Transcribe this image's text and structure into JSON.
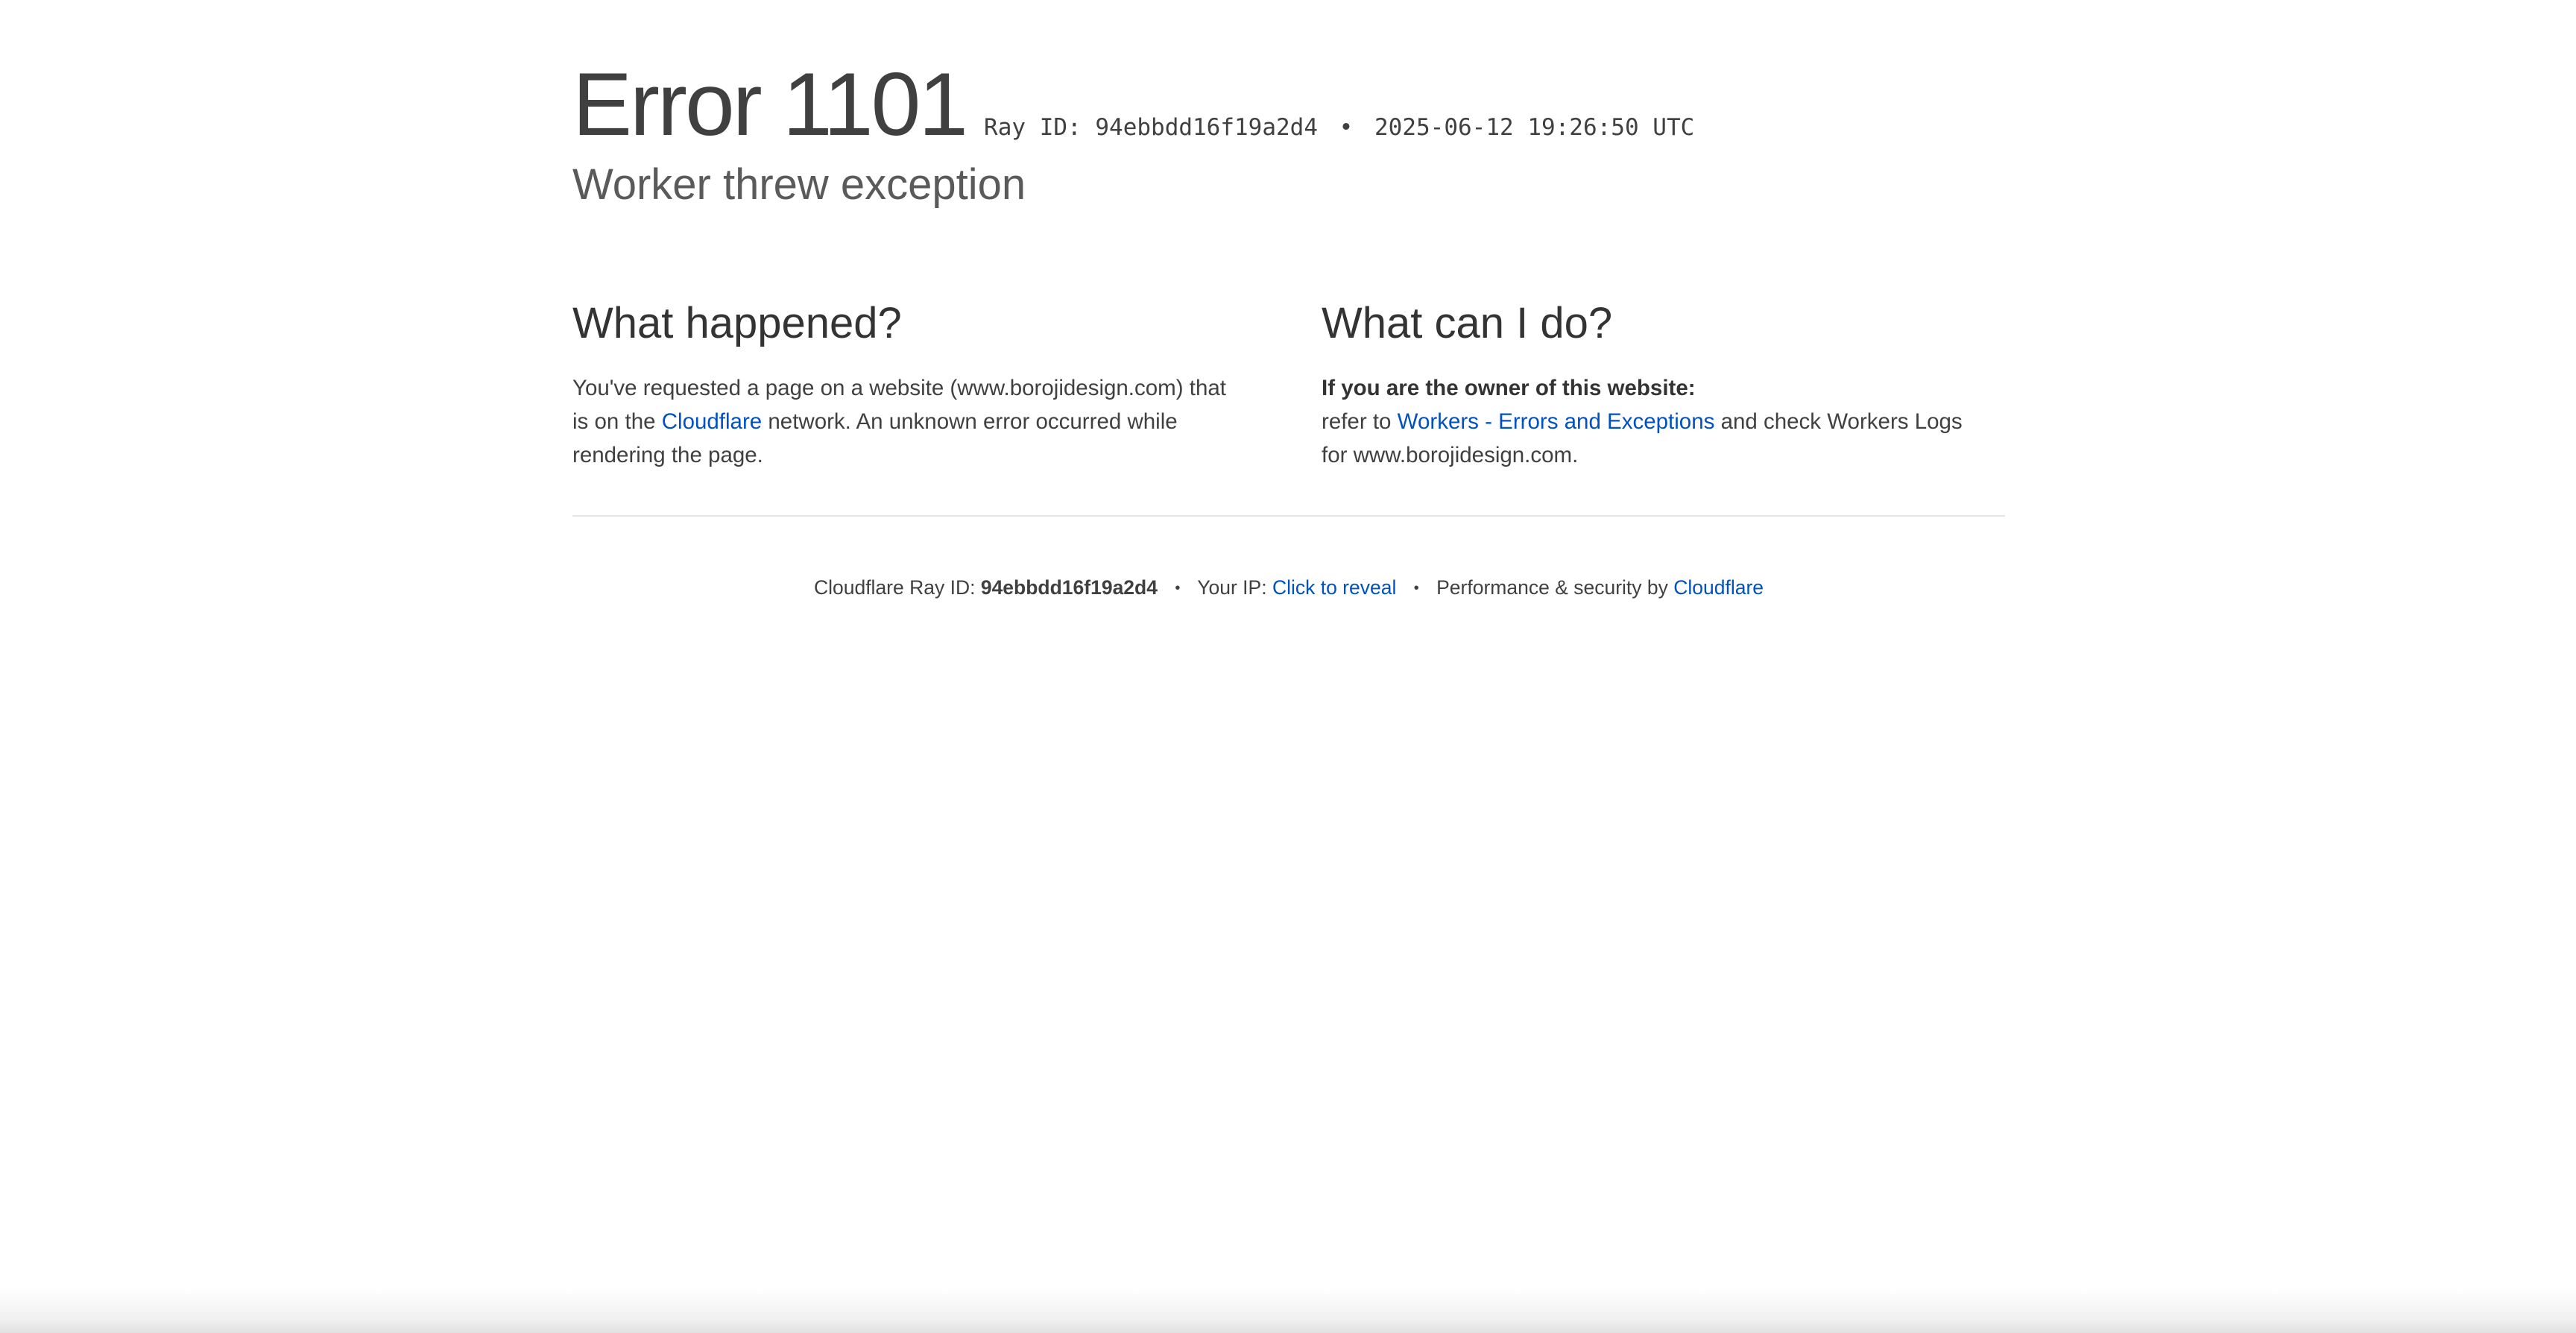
{
  "header": {
    "error_title": "Error 1101",
    "ray_label": "Ray ID:",
    "ray_id": "94ebbdd16f19a2d4",
    "bullet": "•",
    "timestamp": "2025-06-12 19:26:50 UTC",
    "subtitle": "Worker threw exception"
  },
  "what_happened": {
    "heading": "What happened?",
    "text_before_link": "You've requested a page on a website (www.borojidesign.com) that is on the ",
    "link_text": "Cloudflare",
    "text_after_link": " network. An unknown error occurred while rendering the page."
  },
  "what_can_i_do": {
    "heading": "What can I do?",
    "owner_label": "If you are the owner of this website:",
    "text_before_link": "refer to ",
    "link_text": "Workers - Errors and Exceptions",
    "text_after_link": " and check Workers Logs for www.borojidesign.com."
  },
  "footer": {
    "ray_label": "Cloudflare Ray ID: ",
    "ray_id": "94ebbdd16f19a2d4",
    "separator": "•",
    "ip_label": "Your IP: ",
    "ip_link": "Click to reveal",
    "perf_label": "Performance & security by ",
    "perf_link": "Cloudflare"
  },
  "colors": {
    "link": "#0051c3",
    "text": "#404040",
    "divider": "#e5e5e5"
  }
}
